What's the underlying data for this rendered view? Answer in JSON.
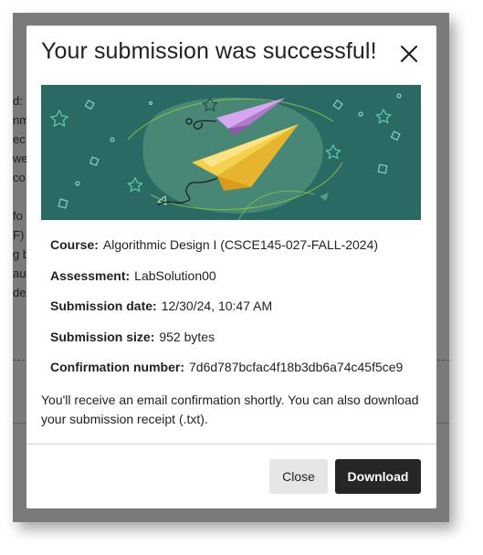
{
  "background": {
    "lines": [
      "d:",
      "nm",
      "ec",
      "we",
      "co",
      "",
      "fo",
      "F)",
      "g b",
      "au",
      "de"
    ]
  },
  "modal": {
    "title": "Your submission was successful!",
    "close_icon": "close-icon",
    "details": [
      {
        "label": "Course:",
        "value": "Algorithmic Design I (CSCE145-027-FALL-2024)"
      },
      {
        "label": "Assessment:",
        "value": "LabSolution00"
      },
      {
        "label": "Submission date:",
        "value": "12/30/24, 10:47 AM"
      },
      {
        "label": "Submission size:",
        "value": "952 bytes"
      },
      {
        "label": "Confirmation number:",
        "value": "7d6d787bcfac4f18b3db6a74c45f5ce9"
      }
    ],
    "message": "You'll receive an email confirmation shortly. You can also download your submission receipt (.txt).",
    "buttons": {
      "close_label": "Close",
      "download_label": "Download"
    }
  },
  "colors": {
    "banner_bg": "#2b6a64",
    "primary_button": "#262626",
    "secondary_button": "#e6e6e6",
    "yellow_plane": "#f2c53d",
    "purple_plane": "#c38ee0"
  }
}
